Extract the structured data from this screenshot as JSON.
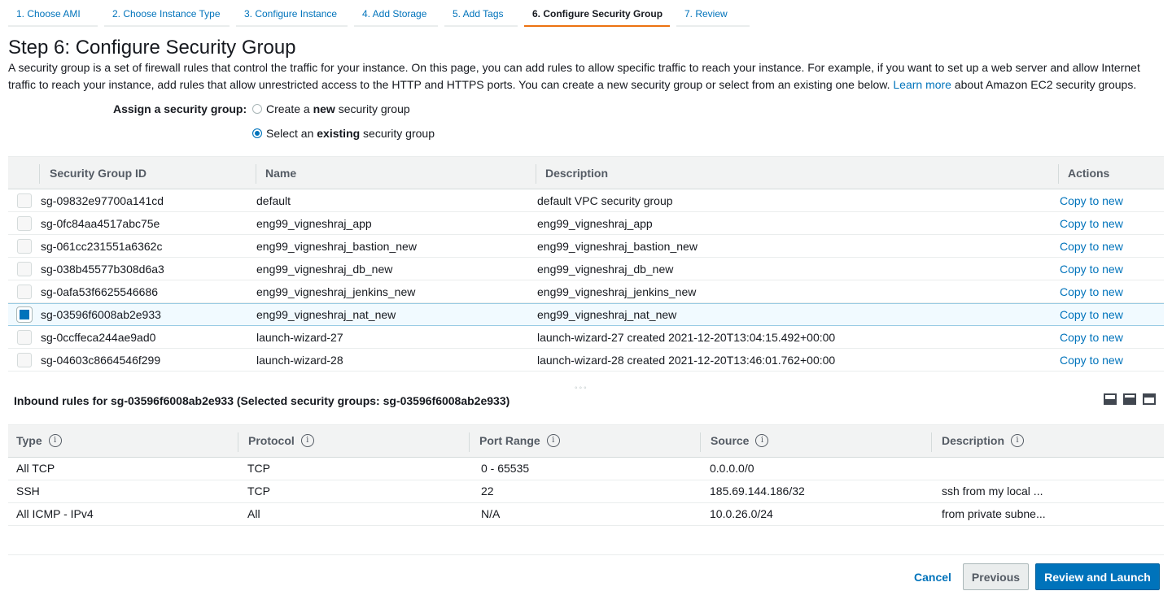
{
  "tabs": [
    {
      "label": "1. Choose AMI"
    },
    {
      "label": "2. Choose Instance Type"
    },
    {
      "label": "3. Configure Instance"
    },
    {
      "label": "4. Add Storage"
    },
    {
      "label": "5. Add Tags"
    },
    {
      "label": "6. Configure Security Group",
      "active": true
    },
    {
      "label": "7. Review"
    }
  ],
  "page": {
    "title": "Step 6: Configure Security Group",
    "intro_text": "A security group is a set of firewall rules that control the traffic for your instance. On this page, you can add rules to allow specific traffic to reach your instance. For example, if you want to set up a web server and allow Internet traffic to reach your instance, add rules that allow unrestricted access to the HTTP and HTTPS ports. You can create a new security group or select from an existing one below.",
    "learn_more": "Learn more",
    "intro_suffix": "about Amazon EC2 security groups."
  },
  "assign": {
    "label": "Assign a security group:",
    "option_new_pre": "Create a ",
    "option_new_bold": "new",
    "option_new_post": " security group",
    "option_existing_pre": "Select an ",
    "option_existing_bold": "existing",
    "option_existing_post": " security group",
    "selected": "existing"
  },
  "sg_table": {
    "headers": {
      "id": "Security Group ID",
      "name": "Name",
      "description": "Description",
      "actions": "Actions"
    },
    "rows": [
      {
        "id": "sg-09832e97700a141cd",
        "name": "default",
        "description": "default VPC security group",
        "action": "Copy to new",
        "checked": false
      },
      {
        "id": "sg-0fc84aa4517abc75e",
        "name": "eng99_vigneshraj_app",
        "description": "eng99_vigneshraj_app",
        "action": "Copy to new",
        "checked": false
      },
      {
        "id": "sg-061cc231551a6362c",
        "name": "eng99_vigneshraj_bastion_new",
        "description": "eng99_vigneshraj_bastion_new",
        "action": "Copy to new",
        "checked": false
      },
      {
        "id": "sg-038b45577b308d6a3",
        "name": "eng99_vigneshraj_db_new",
        "description": "eng99_vigneshraj_db_new",
        "action": "Copy to new",
        "checked": false
      },
      {
        "id": "sg-0afa53f6625546686",
        "name": "eng99_vigneshraj_jenkins_new",
        "description": "eng99_vigneshraj_jenkins_new",
        "action": "Copy to new",
        "checked": false
      },
      {
        "id": "sg-03596f6008ab2e933",
        "name": "eng99_vigneshraj_nat_new",
        "description": "eng99_vigneshraj_nat_new",
        "action": "Copy to new",
        "checked": true
      },
      {
        "id": "sg-0ccffeca244ae9ad0",
        "name": "launch-wizard-27",
        "description": "launch-wizard-27 created 2021-12-20T13:04:15.492+00:00",
        "action": "Copy to new",
        "checked": false
      },
      {
        "id": "sg-04603c8664546f299",
        "name": "launch-wizard-28",
        "description": "launch-wizard-28 created 2021-12-20T13:46:01.762+00:00",
        "action": "Copy to new",
        "checked": false
      }
    ]
  },
  "inbound": {
    "title": "Inbound rules for sg-03596f6008ab2e933 (Selected security groups: sg-03596f6008ab2e933)",
    "headers": {
      "type": "Type",
      "protocol": "Protocol",
      "port_range": "Port Range",
      "source": "Source",
      "description": "Description"
    },
    "info_glyph": "i",
    "rows": [
      {
        "type": "All TCP",
        "protocol": "TCP",
        "port_range": "0 - 65535",
        "source": "0.0.0.0/0",
        "description": ""
      },
      {
        "type": "SSH",
        "protocol": "TCP",
        "port_range": "22",
        "source": "185.69.144.186/32",
        "description": "ssh from my local ..."
      },
      {
        "type": "All ICMP - IPv4",
        "protocol": "All",
        "port_range": "N/A",
        "source": "10.0.26.0/24",
        "description": "from private subne..."
      }
    ]
  },
  "footer": {
    "cancel": "Cancel",
    "previous": "Previous",
    "review_launch": "Review and Launch"
  },
  "colors": {
    "accent": "#0073bb",
    "active_tab": "#ec7211",
    "selected_row": "#f1faff"
  }
}
